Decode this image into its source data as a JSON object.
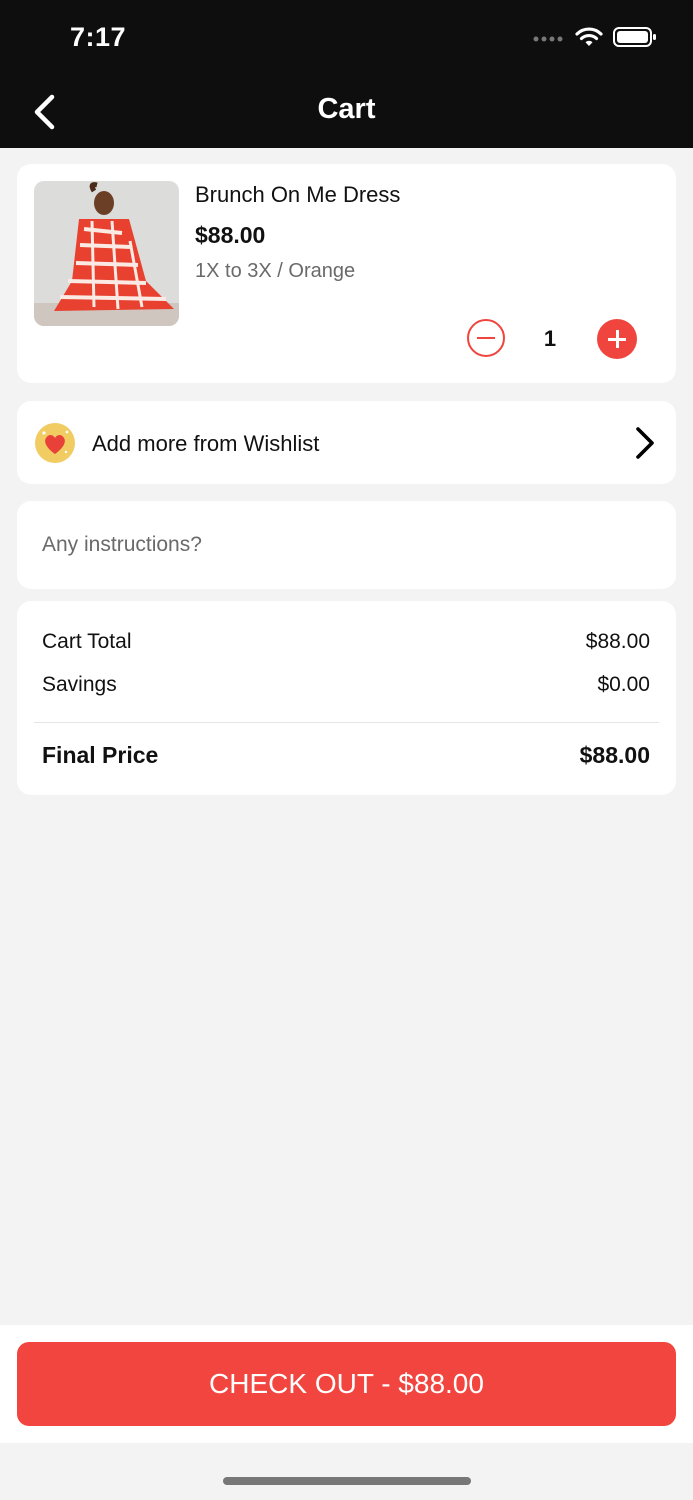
{
  "status_bar": {
    "time": "7:17",
    "icons": [
      "signal-icon",
      "wifi-icon",
      "battery-icon"
    ]
  },
  "nav": {
    "title": "Cart",
    "back_icon": "chevron-left-icon"
  },
  "cart_item": {
    "name": "Brunch On Me Dress",
    "price": "$88.00",
    "variant": "1X to 3X / Orange",
    "quantity": "1",
    "minus_icon": "minus-circle-icon",
    "plus_icon": "plus-circle-icon"
  },
  "wishlist": {
    "label": "Add more from Wishlist",
    "icon": "heart-icon",
    "chevron_icon": "chevron-right-icon"
  },
  "instructions": {
    "placeholder": "Any instructions?",
    "value": ""
  },
  "summary": {
    "cart_total_label": "Cart Total",
    "cart_total_value": "$88.00",
    "savings_label": "Savings",
    "savings_value": "$0.00",
    "final_label": "Final Price",
    "final_value": "$88.00"
  },
  "checkout": {
    "label": "CHECK OUT - $88.00"
  },
  "colors": {
    "accent": "#f2453f",
    "header_bg": "#0e0e0e",
    "page_bg": "#f3f3f3",
    "wishlist_badge": "#f1cc62"
  }
}
